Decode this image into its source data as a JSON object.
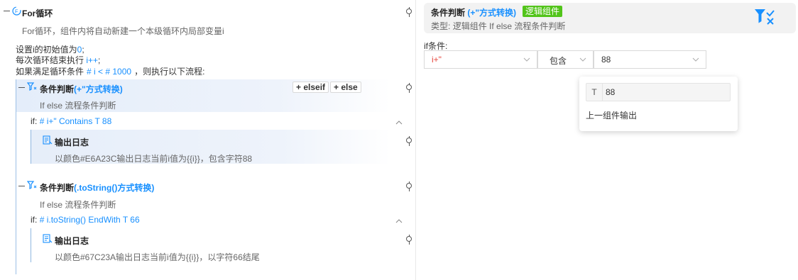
{
  "left": {
    "loop": {
      "title": "For循环",
      "desc": "For循环，组件内将自动新建一个本级循环内局部变量i",
      "line1_prefix": "设置i的初始值为",
      "line1_value": "0",
      "line1_suffix": ";",
      "line2_prefix": "每次循环结束执行 ",
      "line2_value": "i++",
      "line2_suffix": ";",
      "line3_prefix": "如果满足循环条件",
      "line3_cond": "# i < # 1000",
      "line3_suffix": "，则执行以下流程:"
    },
    "cond1": {
      "title": "条件判断",
      "title_paren": "(+\"方式转换)",
      "elseif": "+ elseif",
      "else": "+ else",
      "desc": "If else 流程条件判断",
      "if_label": "if:",
      "if_expr": "# i+\" Contains T 88",
      "log_title": "输出日志",
      "log_desc": "以颜色#E6A23C输出日志当前i值为{{i}}，包含字符88"
    },
    "cond2": {
      "title": "条件判断",
      "title_paren": "(.toString()方式转换)",
      "desc": "If else 流程条件判断",
      "if_label": "if:",
      "if_expr": "# i.toString() EndWith T 66",
      "log_title": "输出日志",
      "log_desc": "以颜色#67C23A输出日志当前i值为{{i}}，以字符66结尾"
    }
  },
  "right": {
    "header": {
      "title": "条件判断",
      "title_paren": "(+\"方式转换)",
      "badge": "逻辑组件",
      "type_label": "类型:",
      "type_value": "逻辑组件 If else 流程条件判断"
    },
    "if_label": "if条件:",
    "select_var": "i+\"",
    "select_op": "包含",
    "select_value": "88",
    "dropdown": {
      "type_glyph": "T",
      "input_value": "88",
      "option": "上一组件输出"
    }
  },
  "colors": {
    "accent": "#1890ff",
    "badge": "#52c41a",
    "highlight": "#eaf1fb"
  }
}
